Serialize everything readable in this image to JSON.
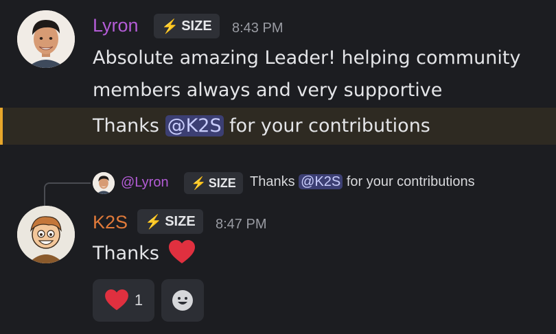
{
  "messages": [
    {
      "author": "Lyron",
      "author_color": "#b35cd6",
      "tag": "SIZE",
      "time": "8:43 PM",
      "lines": [
        "Absolute amazing Leader! helping community",
        "members always and very supportive"
      ],
      "highlighted_line": {
        "before": "Thanks ",
        "mention": "@K2S",
        "after": " for your contributions"
      }
    },
    {
      "reply": {
        "author": "@Lyron",
        "tag": "SIZE",
        "text_before": "Thanks ",
        "mention": "@K2S",
        "text_after": " for your contributions"
      },
      "author": "K2S",
      "author_color": "#e07a3a",
      "tag": "SIZE",
      "time": "8:47 PM",
      "text": "Thanks",
      "emoji": "heart-emoji",
      "reactions": [
        {
          "icon": "heart-emoji",
          "count": "1"
        },
        {
          "icon": "add-reaction-smiley-icon",
          "count": ""
        }
      ]
    }
  ],
  "colors": {
    "background": "#1c1d21",
    "mention_bg": "#3c3f73",
    "highlight_bg": "#2e2a22",
    "highlight_bar": "#e8a72b",
    "heart": "#e0303f"
  }
}
